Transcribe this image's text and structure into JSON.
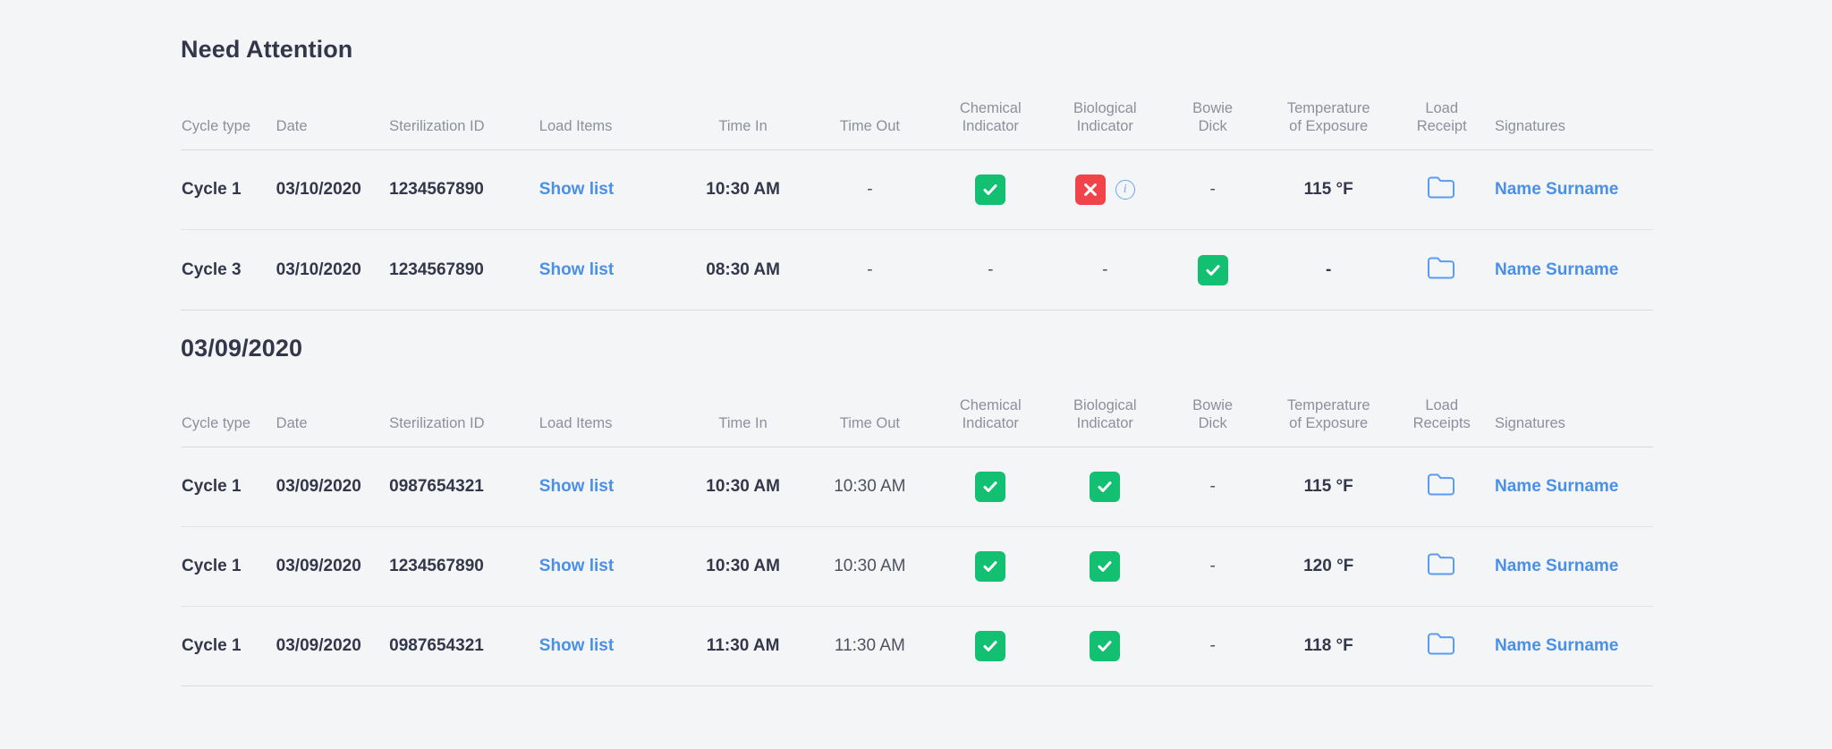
{
  "colors": {
    "background": "#f4f5f7",
    "text": "#32384a",
    "muted": "#8b909c",
    "link": "#4a90e8",
    "success": "#13bf70",
    "danger": "#f0444a",
    "info": "#67a8f0"
  },
  "sections": [
    {
      "title": "Need Attention",
      "columns": [
        "Cycle type",
        "Date",
        "Sterilization ID",
        "Load Items",
        "Time In",
        "Time Out",
        "Chemical\nIndicator",
        "Biological\nIndicator",
        "Bowie\nDick",
        "Temperature\nof Exposure",
        "Load\nReceipt",
        "Signatures"
      ],
      "rows": [
        {
          "cycle_type": "Cycle 1",
          "date": "03/10/2020",
          "sterilization_id": "1234567890",
          "load_items": "Show list",
          "time_in": "10:30 AM",
          "time_out": "-",
          "chemical_indicator": "pass",
          "biological_indicator": "fail",
          "biological_has_info": true,
          "bowie_dick": "-",
          "temperature": "115 °F",
          "load_receipt": "folder-icon",
          "signature": "Name Surname"
        },
        {
          "cycle_type": "Cycle 3",
          "date": "03/10/2020",
          "sterilization_id": "1234567890",
          "load_items": "Show list",
          "time_in": "08:30 AM",
          "time_out": "-",
          "chemical_indicator": "-",
          "biological_indicator": "-",
          "biological_has_info": false,
          "bowie_dick": "pass",
          "temperature": "-",
          "load_receipt": "folder-icon",
          "signature": "Name Surname"
        }
      ]
    },
    {
      "title": "03/09/2020",
      "columns": [
        "Cycle type",
        "Date",
        "Sterilization ID",
        "Load Items",
        "Time In",
        "Time Out",
        "Chemical\nIndicator",
        "Biological\nIndicator",
        "Bowie\nDick",
        "Temperature\nof Exposure",
        "Load\nReceipts",
        "Signatures"
      ],
      "rows": [
        {
          "cycle_type": "Cycle 1",
          "date": "03/09/2020",
          "sterilization_id": "0987654321",
          "load_items": "Show list",
          "time_in": "10:30 AM",
          "time_out": "10:30 AM",
          "chemical_indicator": "pass",
          "biological_indicator": "pass",
          "biological_has_info": false,
          "bowie_dick": "-",
          "temperature": "115 °F",
          "load_receipt": "folder-icon",
          "signature": "Name Surname"
        },
        {
          "cycle_type": "Cycle 1",
          "date": "03/09/2020",
          "sterilization_id": "1234567890",
          "load_items": "Show list",
          "time_in": "10:30 AM",
          "time_out": "10:30 AM",
          "chemical_indicator": "pass",
          "biological_indicator": "pass",
          "biological_has_info": false,
          "bowie_dick": "-",
          "temperature": "120 °F",
          "load_receipt": "folder-icon",
          "signature": "Name Surname"
        },
        {
          "cycle_type": "Cycle 1",
          "date": "03/09/2020",
          "sterilization_id": "0987654321",
          "load_items": "Show list",
          "time_in": "11:30 AM",
          "time_out": "11:30 AM",
          "chemical_indicator": "pass",
          "biological_indicator": "pass",
          "biological_has_info": false,
          "bowie_dick": "-",
          "temperature": "118 °F",
          "load_receipt": "folder-icon",
          "signature": "Name Surname"
        }
      ]
    }
  ],
  "icons": {
    "info": "i",
    "check": "check-icon",
    "cross": "cross-icon",
    "folder": "folder-icon"
  }
}
